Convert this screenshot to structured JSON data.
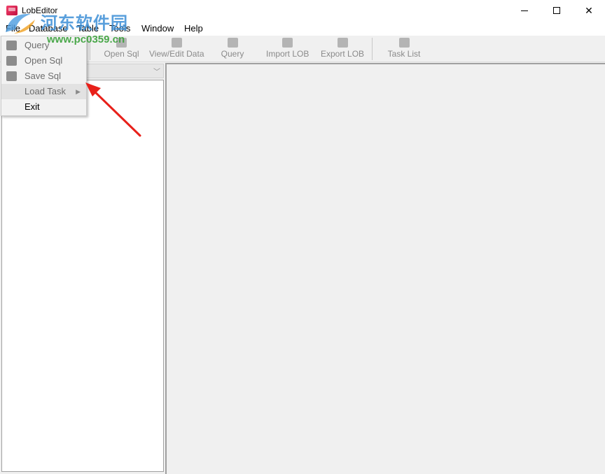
{
  "window": {
    "title": "LobEditor",
    "controls": {
      "minimize": "minimize",
      "maximize": "maximize",
      "close": "✕"
    }
  },
  "menubar": [
    {
      "label": "File"
    },
    {
      "label": "Database"
    },
    {
      "label": "Table"
    },
    {
      "label": "Tools"
    },
    {
      "label": "Window"
    },
    {
      "label": "Help"
    }
  ],
  "toolbar": {
    "buttons": [
      {
        "label": "Open Sql",
        "icon": "folder-icon"
      },
      {
        "label": "View/Edit Data",
        "icon": "edit-data-icon"
      },
      {
        "label": "Query",
        "icon": "query-icon"
      },
      {
        "label": "Import LOB",
        "icon": "import-icon"
      },
      {
        "label": "Export LOB",
        "icon": "export-icon"
      },
      {
        "label": "Task List",
        "icon": "task-list-icon"
      }
    ]
  },
  "file_menu": {
    "items": [
      {
        "label": "Query",
        "icon": "query-icon",
        "enabled": false
      },
      {
        "label": "Open Sql",
        "icon": "folder-icon",
        "enabled": false
      },
      {
        "label": "Save Sql",
        "icon": "save-icon",
        "enabled": false
      },
      {
        "label": "Load Task",
        "has_submenu": true,
        "enabled": false,
        "highlighted": true
      },
      {
        "label": "Exit",
        "enabled": true
      }
    ],
    "submenu_arrow": "▶"
  },
  "combo": {
    "arrow": "﹀"
  },
  "watermark": {
    "title": "河东软件园",
    "url": "www.pc0359.cn"
  },
  "colors": {
    "accent_annotation": "#e8201a",
    "watermark_blue": "#3d8fd6",
    "watermark_green": "#3aa13a"
  }
}
